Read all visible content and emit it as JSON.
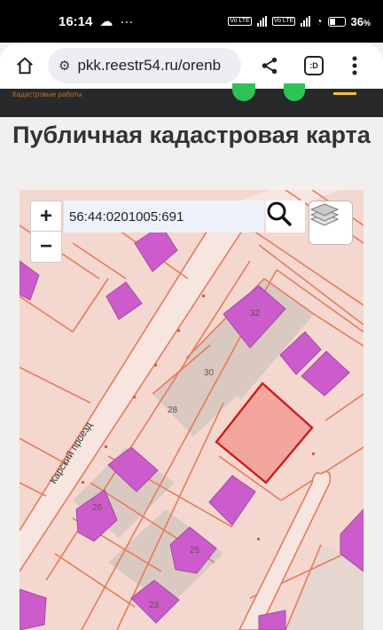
{
  "status": {
    "time": "16:14",
    "battery": "36",
    "battery_unit": "%",
    "volte1": "Vo LTE",
    "volte2": "Vo LTE",
    "menu_dots": "···"
  },
  "browser": {
    "url": "pkk.reestr54.ru/orenb",
    "tabs_label": ":D"
  },
  "site": {
    "brand": "Кадастровые работы"
  },
  "page": {
    "title": "Публичная кадастровая карта"
  },
  "map": {
    "zoom_in": "+",
    "zoom_out": "−",
    "search_value": "56:44:0201005:691",
    "search_placeholder": "",
    "street": "Карский проезд",
    "labels": [
      "32",
      "30",
      "28",
      "26",
      "25",
      "23"
    ],
    "colors": {
      "background": "#f4d8cf",
      "parcel_line": "#e8795b",
      "building": "#cc5ccc",
      "selected_fill": "#f3a79c",
      "selected_stroke": "#d11a1a"
    }
  }
}
